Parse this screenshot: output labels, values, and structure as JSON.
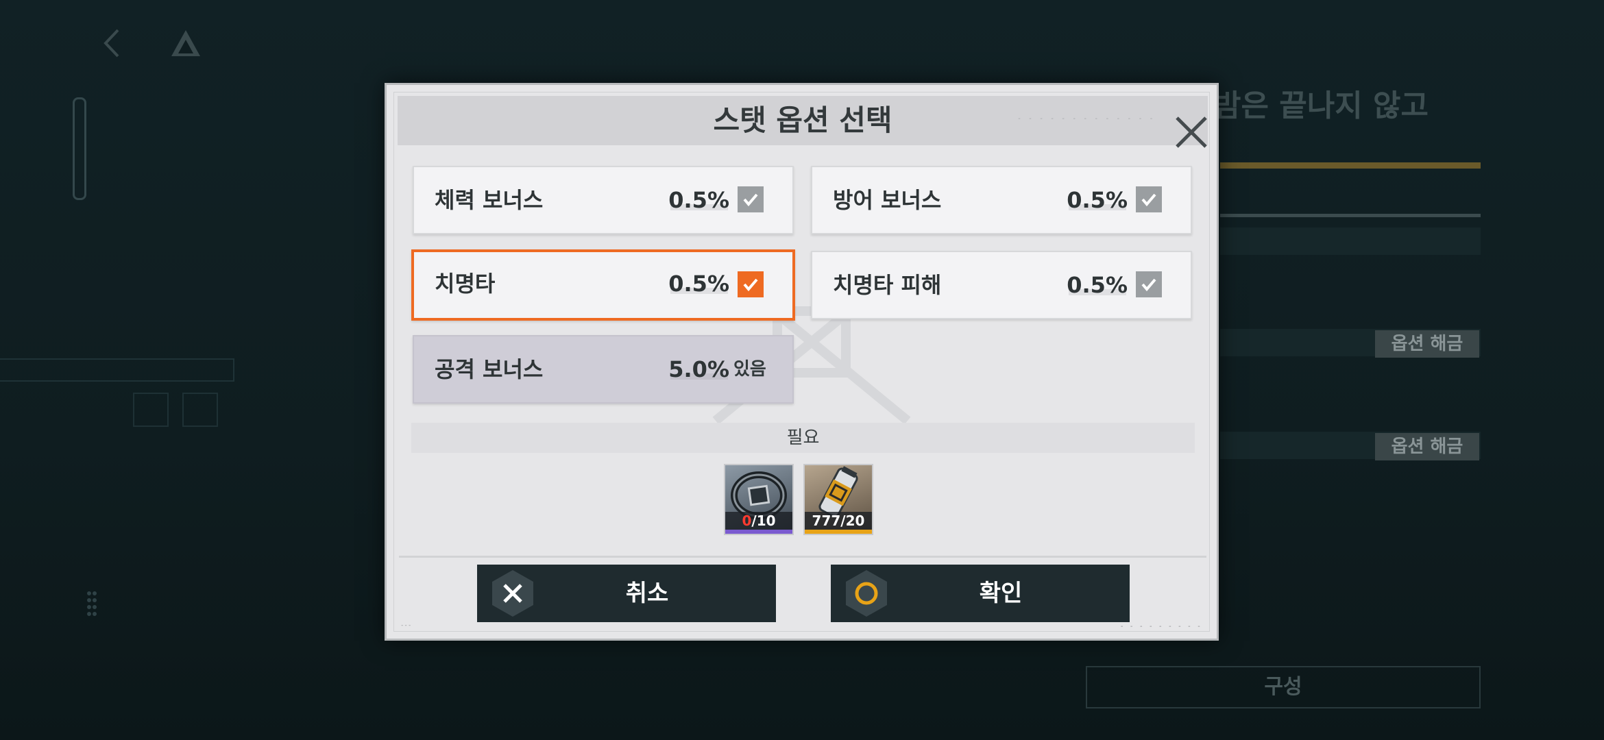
{
  "background": {
    "title": "밤은 끝나지 않고",
    "option_unlock_1": "옵션 해금",
    "option_unlock_2": "옵션 해금",
    "compose_button": "구성"
  },
  "dialog": {
    "title": "스탯 옵션 선택",
    "options": [
      {
        "label": "체력 보너스",
        "value": "0.5%",
        "checked": true,
        "selected": false
      },
      {
        "label": "방어 보너스",
        "value": "0.5%",
        "checked": true,
        "selected": false
      },
      {
        "label": "치명타",
        "value": "0.5%",
        "checked": true,
        "selected": true
      },
      {
        "label": "치명타 피해",
        "value": "0.5%",
        "checked": true,
        "selected": false
      }
    ],
    "owned_option": {
      "label": "공격 보너스",
      "value": "5.0%",
      "status": "있음"
    },
    "required_label": "필요",
    "items": [
      {
        "icon": "ring-core-icon",
        "have": "0",
        "need": "/10",
        "stripe_color": "#7b5bd0"
      },
      {
        "icon": "canister-icon",
        "have": "777",
        "need": "/20",
        "stripe_color": "#e8a317"
      }
    ],
    "cancel_label": "취소",
    "confirm_label": "확인"
  },
  "colors": {
    "accent": "#ee6a22",
    "button_bg": "#1f2b2f",
    "confirm_ring": "#e8a317"
  }
}
